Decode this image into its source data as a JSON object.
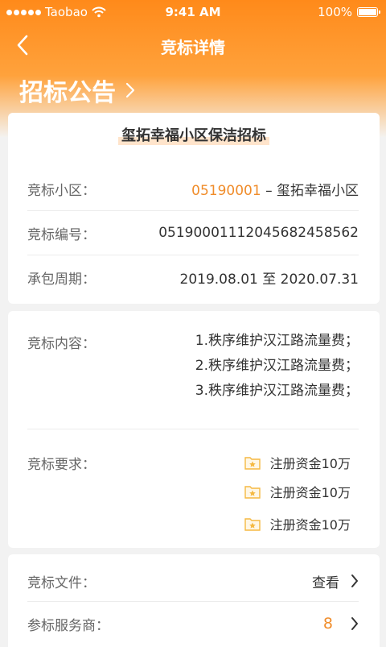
{
  "status_bar": {
    "carrier": "Taobao",
    "time": "9:41 AM",
    "battery": "100%"
  },
  "nav": {
    "title": "竞标详情"
  },
  "section": {
    "title": "招标公告"
  },
  "project": {
    "title": "玺拓幸福小区保洁招标",
    "community_label": "竞标小区：",
    "community_code": "05190001",
    "community_name": " – 玺拓幸福小区",
    "number_label": "竞标编号：",
    "number_value": "0519000111204568245856​2",
    "period_label": "承包周期：",
    "period_value": "2019.08.01 至 2020.07.31"
  },
  "content": {
    "label": "竞标内容：",
    "lines": [
      "1.秩序维护汉江路流量费；",
      "2.秩序维护汉江路流量费；",
      "3.秩序维护汉江路流量费；"
    ]
  },
  "requirements": {
    "label": "竞标要求：",
    "items": [
      "注册资金10万",
      "注册资金10万",
      "注册资金10万"
    ],
    "icon": "certificate-icon",
    "icon_color": "#f5b942"
  },
  "files": {
    "label": "竞标文件：",
    "action": "查看"
  },
  "bidders": {
    "label": "参标服务商：",
    "count": "8"
  },
  "colors": {
    "accent": "#f08c2a",
    "header_orange": "#ff8a1a"
  }
}
